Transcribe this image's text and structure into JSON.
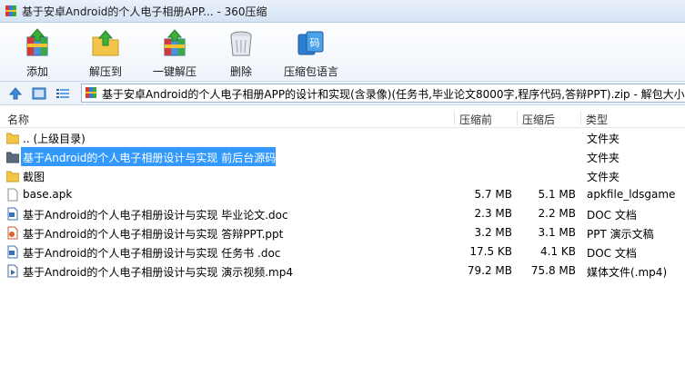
{
  "window": {
    "title": "基于安卓Android的个人电子相册APP... - 360压缩"
  },
  "toolbar": {
    "buttons": [
      {
        "label": "添加",
        "icon": "add-archive-icon"
      },
      {
        "label": "解压到",
        "icon": "extract-to-icon"
      },
      {
        "label": "一键解压",
        "icon": "one-click-extract-icon"
      },
      {
        "label": "删除",
        "icon": "trash-icon"
      },
      {
        "label": "压缩包语言",
        "icon": "archive-language-icon"
      }
    ]
  },
  "address": {
    "path": "基于安卓Android的个人电子相册APP的设计和实现(含录像)(任务书,毕业论文8000字,程序代码,答辩PPT).zip - 解包大小为"
  },
  "columns": {
    "name": "名称",
    "compressed": "压缩前",
    "original": "压缩后",
    "type": "类型"
  },
  "files": [
    {
      "name": ".. (上级目录)",
      "compressed": "",
      "original": "",
      "type": "文件夹",
      "icon": "folder-icon",
      "selected": false
    },
    {
      "name": "基于Android的个人电子相册设计与实现 前后台源码",
      "compressed": "",
      "original": "",
      "type": "文件夹",
      "icon": "folder-icon",
      "selected": true
    },
    {
      "name": "截图",
      "compressed": "",
      "original": "",
      "type": "文件夹",
      "icon": "folder-icon",
      "selected": false
    },
    {
      "name": "base.apk",
      "compressed": "5.7 MB",
      "original": "5.1 MB",
      "type": "apkfile_ldsgame",
      "icon": "file-icon",
      "selected": false
    },
    {
      "name": "基于Android的个人电子相册设计与实现 毕业论文.doc",
      "compressed": "2.3 MB",
      "original": "2.2 MB",
      "type": "DOC 文档",
      "icon": "doc-icon",
      "selected": false
    },
    {
      "name": "基于Android的个人电子相册设计与实现 答辩PPT.ppt",
      "compressed": "3.2 MB",
      "original": "3.1 MB",
      "type": "PPT 演示文稿",
      "icon": "ppt-icon",
      "selected": false
    },
    {
      "name": "基于Android的个人电子相册设计与实现 任务书 .doc",
      "compressed": "17.5 KB",
      "original": "4.1 KB",
      "type": "DOC 文档",
      "icon": "doc-icon",
      "selected": false
    },
    {
      "name": "基于Android的个人电子相册设计与实现 演示视频.mp4",
      "compressed": "79.2 MB",
      "original": "75.8 MB",
      "type": "媒体文件(.mp4)",
      "icon": "video-icon",
      "selected": false
    }
  ]
}
